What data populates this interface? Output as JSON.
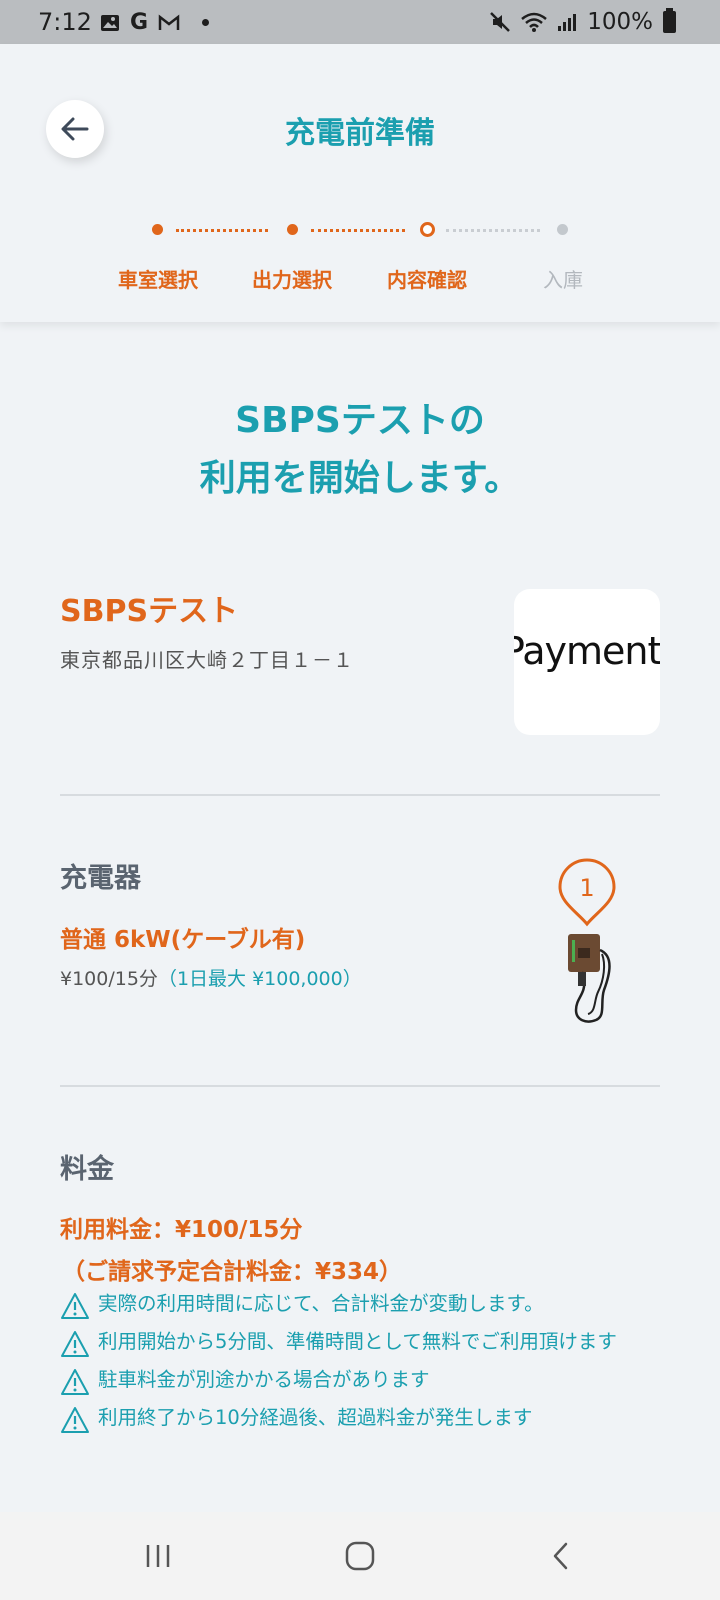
{
  "status_bar": {
    "time": "7:12",
    "battery": "100%",
    "icons": [
      "image-icon",
      "google-icon",
      "gmail-icon",
      "dot-icon",
      "mute-icon",
      "wifi-icon",
      "signal-icon",
      "battery-icon"
    ]
  },
  "header": {
    "title": "充電前準備",
    "back_icon": "arrow-left-icon",
    "steps": [
      {
        "label": "車室選択",
        "state": "done"
      },
      {
        "label": "出力選択",
        "state": "done"
      },
      {
        "label": "内容確認",
        "state": "current"
      },
      {
        "label": "入庫",
        "state": "todo"
      }
    ]
  },
  "intro": {
    "line1": "SBPSテストの",
    "line2": "利用を開始します。"
  },
  "station": {
    "name": "SBPSテスト",
    "address": "東京都品川区大崎２丁目１－１",
    "logo_text": "Payment"
  },
  "charger": {
    "heading": "充電器",
    "pin_number": "1",
    "type": "普通 6kW(ケーブル有)",
    "price": "¥100/15分",
    "daily_max": "（1日最大 ¥100,000）"
  },
  "fee": {
    "heading": "料金",
    "usage_fee": "利用料金：¥100/15分",
    "total": "（ご請求予定合計料金：¥334）",
    "notes": [
      "実際の利用時間に応じて、合計料金が変動します。",
      "利用開始から5分間、準備時間として無料でご利用頂けます",
      "駐車料金が別途かかる場合があります",
      "利用終了から10分経過後、超過料金が発生します"
    ]
  },
  "nav": {
    "recents": "recents-icon",
    "home": "home-icon",
    "back": "back-icon"
  },
  "colors": {
    "accent_teal": "#1b9faf",
    "accent_orange": "#e0661b",
    "background": "#f0f3f6"
  }
}
